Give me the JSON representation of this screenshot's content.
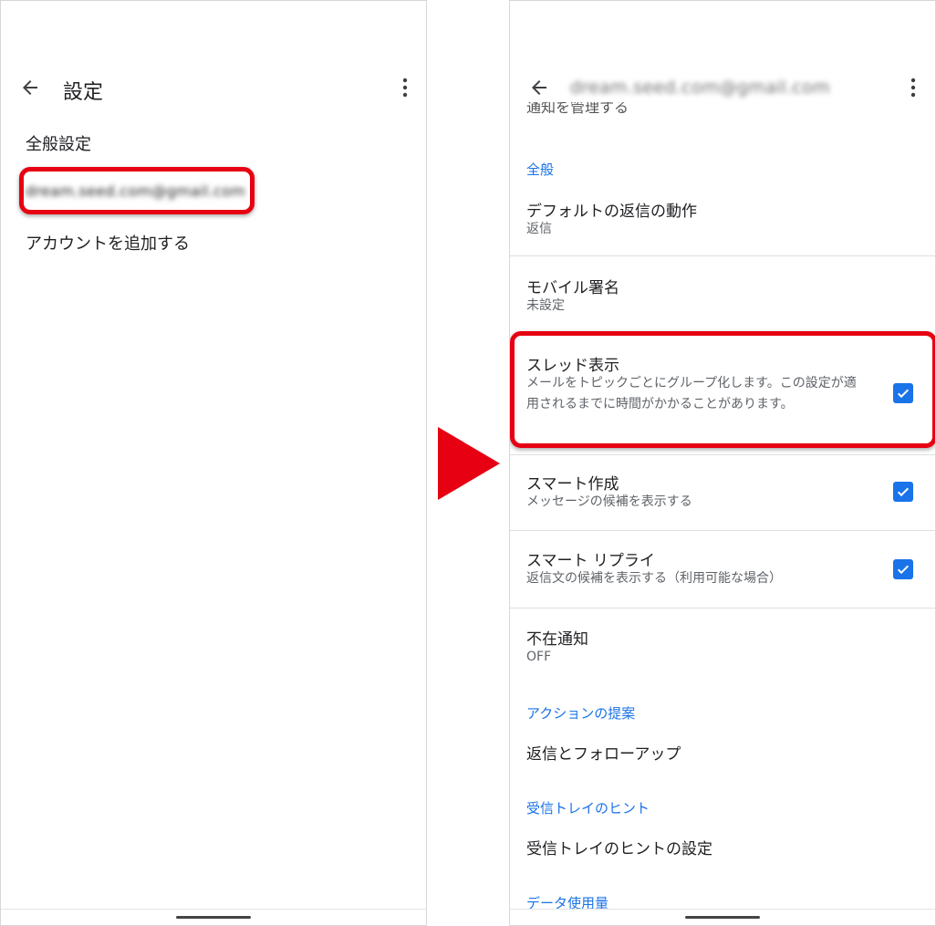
{
  "left": {
    "title": "設定",
    "items": {
      "general": "全般設定",
      "account": "dream.seed.com@gmail.com",
      "add_account": "アカウントを追加する"
    }
  },
  "right": {
    "title": "dream.seed.com@gmail.com",
    "clipped_text": "通知を管理する",
    "sections": {
      "general": "全般",
      "actions": "アクションの提案",
      "inbox_tips": "受信トレイのヒント",
      "data_usage": "データ使用量"
    },
    "rows": {
      "reply_default": {
        "title": "デフォルトの返信の動作",
        "sub": "返信"
      },
      "mobile_signature": {
        "title": "モバイル署名",
        "sub": "未設定"
      },
      "thread_view": {
        "title": "スレッド表示",
        "sub": "メールをトピックごとにグループ化します。この設定が適用されるまでに時間がかかることがあります。",
        "checked": true
      },
      "smart_compose": {
        "title": "スマート作成",
        "sub": "メッセージの候補を表示する",
        "checked": true
      },
      "smart_reply": {
        "title": "スマート リプライ",
        "sub": "返信文の候補を表示する（利用可能な場合）",
        "checked": true
      },
      "vacation": {
        "title": "不在通知",
        "sub": "OFF"
      },
      "reply_followup": {
        "title": "返信とフォローアップ"
      },
      "inbox_tips_settings": {
        "title": "受信トレイのヒントの設定"
      }
    }
  },
  "colors": {
    "accent": "#1a73e8",
    "highlight": "#e60012",
    "divider": "#dedede"
  },
  "icons": [
    "back-arrow-icon",
    "more-vert-icon",
    "checkbox-checked-icon",
    "right-triangle-arrow-icon"
  ]
}
